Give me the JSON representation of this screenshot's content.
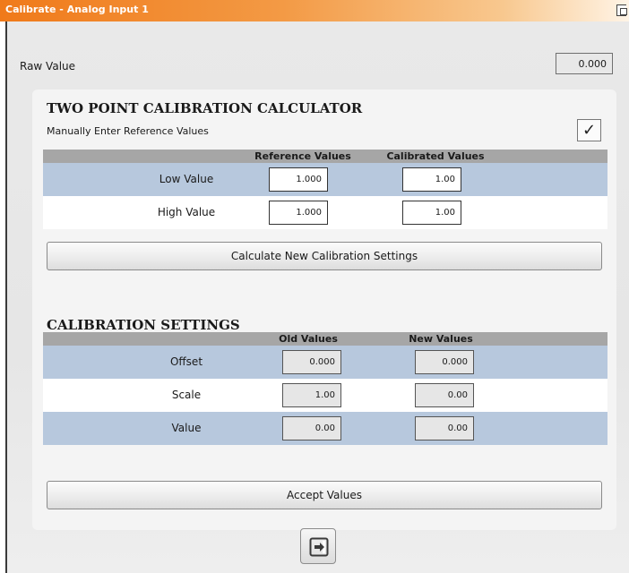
{
  "window": {
    "title": "Calibrate - Analog Input 1"
  },
  "raw": {
    "label": "Raw Value",
    "value": "0.000"
  },
  "calculator": {
    "title": "TWO POINT CALIBRATION CALCULATOR",
    "manual_label": "Manually Enter Reference Values",
    "manual_checked": true,
    "checkmark": "✓",
    "columns": [
      "Reference Values",
      "Calibrated Values"
    ],
    "rows": [
      {
        "label": "Low Value",
        "reference": "1.000",
        "calibrated": "1.00"
      },
      {
        "label": "High Value",
        "reference": "1.000",
        "calibrated": "1.00"
      }
    ],
    "button_label": "Calculate New Calibration Settings"
  },
  "settings": {
    "title": "CALIBRATION SETTINGS",
    "columns": [
      "Old Values",
      "New Values"
    ],
    "rows": [
      {
        "label": "Offset",
        "old": "0.000",
        "new": "0.000"
      },
      {
        "label": "Scale",
        "old": "1.00",
        "new": "0.00"
      },
      {
        "label": "Value",
        "old": "0.00",
        "new": "0.00"
      }
    ],
    "button_label": "Accept Values"
  },
  "icons": {
    "corner": "window-restore-icon",
    "exit": "exit-door-icon"
  },
  "colors": {
    "title_gradient_start": "#f07a1a",
    "row_highlight": "#b7c8dd",
    "header_gray": "#a6a6a6"
  }
}
